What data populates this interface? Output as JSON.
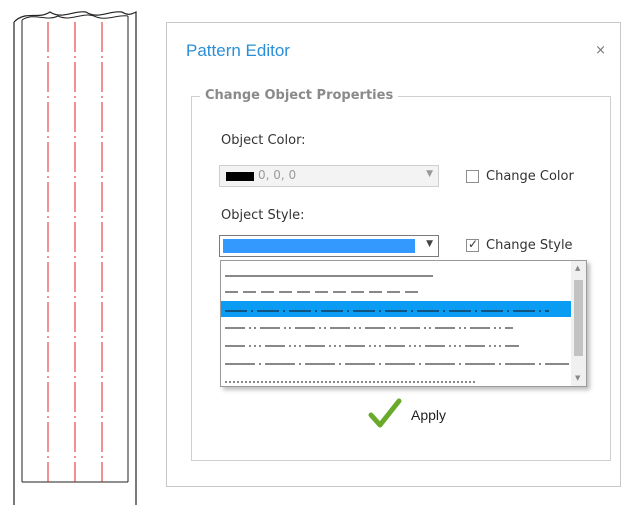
{
  "dialog": {
    "title": "Pattern Editor",
    "close_glyph": "×",
    "group_title": "Change Object Properties",
    "object_color_label": "Object Color:",
    "color_value": "0, 0, 0",
    "color_swatch": "#000000",
    "change_color_label": "Change Color",
    "change_color_checked": false,
    "object_style_label": "Object Style:",
    "style_selected_color": "#3399ff",
    "change_style_label": "Change Style",
    "change_style_checked": true,
    "style_options": [
      {
        "name": "solid",
        "selected": false
      },
      {
        "name": "dashed",
        "selected": false
      },
      {
        "name": "dash-dot",
        "selected": true
      },
      {
        "name": "dash-dot-dot",
        "selected": false
      },
      {
        "name": "dash-dot-dot-dot",
        "selected": false
      },
      {
        "name": "long-dash-dot",
        "selected": false
      },
      {
        "name": "dotted",
        "selected": false
      }
    ],
    "apply_label": "Apply",
    "apply_icon": "check-icon"
  },
  "preview": {
    "line_color": "#e02020",
    "line_style": "dash-dot"
  },
  "colors": {
    "title": "#2a8fd6",
    "selection": "#0a9bf2",
    "check": "#6aaa2a"
  }
}
